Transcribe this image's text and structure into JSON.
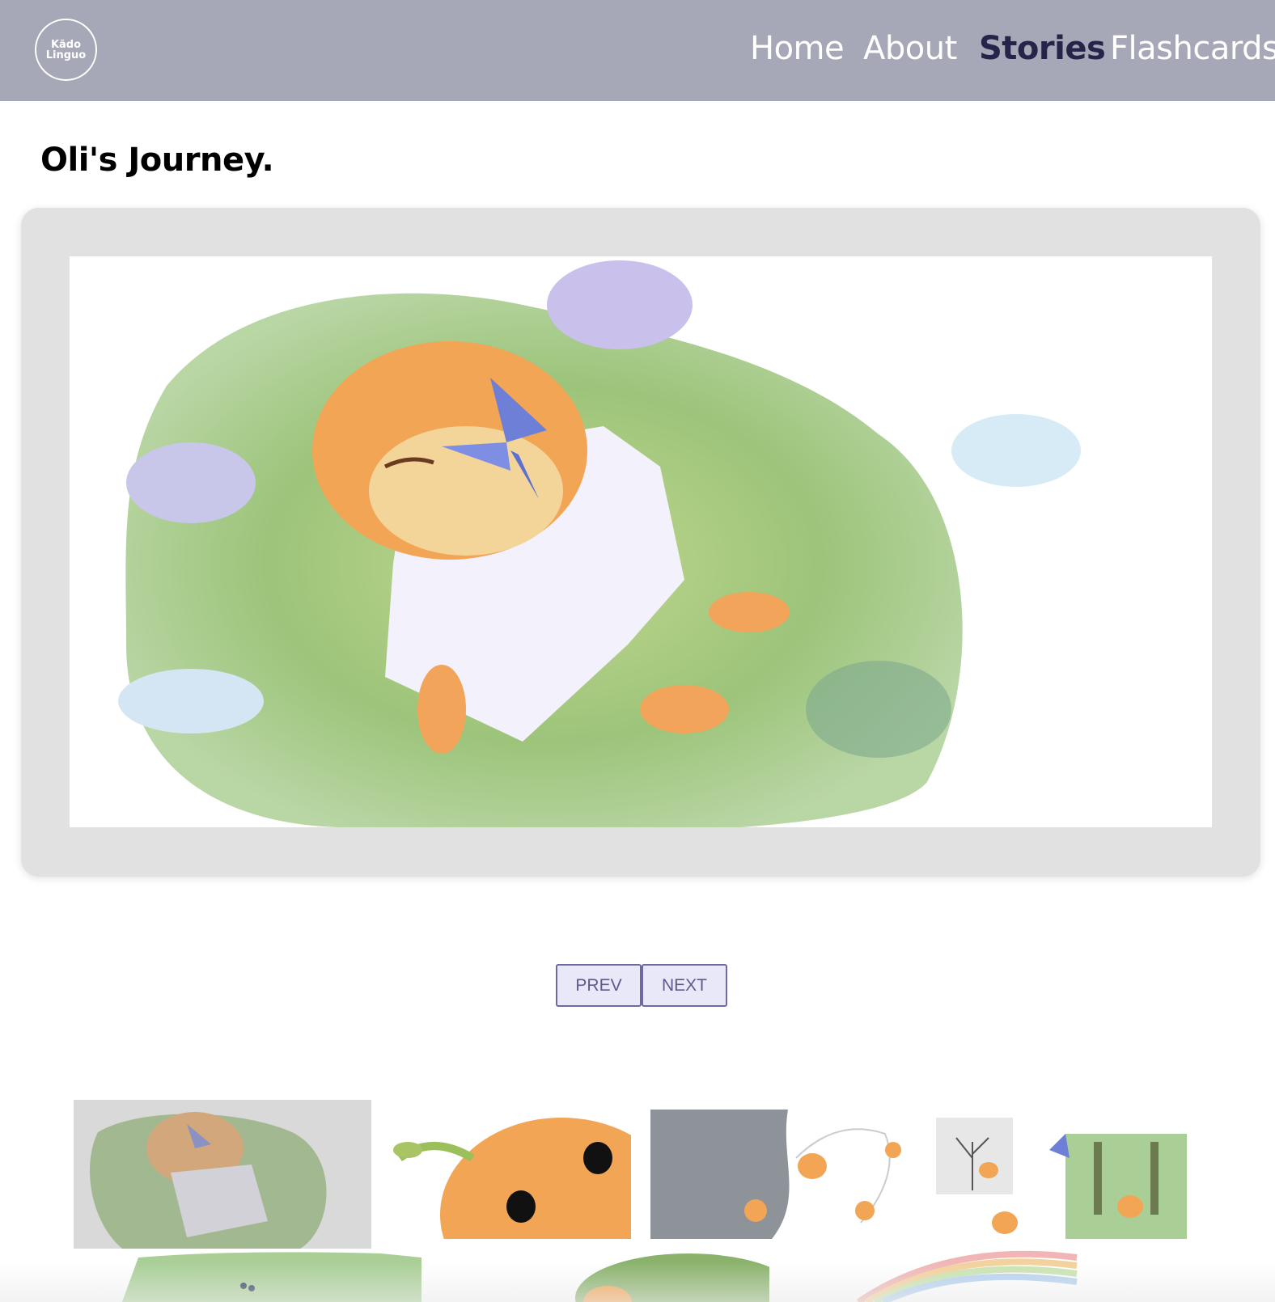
{
  "logo": {
    "line1": "Kādo",
    "line2": "Linguo"
  },
  "nav": {
    "items": [
      {
        "label": "Home",
        "active": false
      },
      {
        "label": "About",
        "active": false
      },
      {
        "label": "Stories",
        "active": true
      },
      {
        "label": "Flashcards",
        "active": false
      }
    ]
  },
  "story": {
    "title": "Oli's Journey."
  },
  "pager": {
    "prev_label": "PREV",
    "next_label": "NEXT"
  },
  "thumbnails": {
    "count_visible": 8,
    "selected_index": 0
  },
  "colors": {
    "header_bg": "#a6a8b8",
    "nav_active": "#27244a",
    "viewer_bg": "#e1e1e1",
    "button_bg": "#e9e8f8",
    "button_border": "#6d6aa2",
    "button_text": "#5d5a8e"
  }
}
